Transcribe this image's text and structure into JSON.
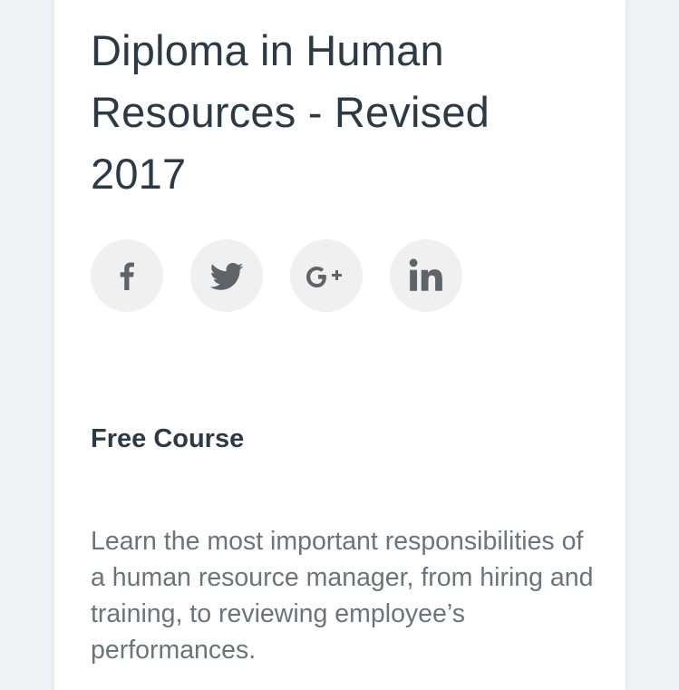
{
  "course": {
    "title": "Diploma in Human Resources - Revised 2017",
    "price_label": "Free Course",
    "description": "Learn the most important responsibilities of a human resource manager, from hiring and training, to reviewing employee’s performances."
  },
  "share": {
    "buttons": [
      {
        "icon": "facebook-icon"
      },
      {
        "icon": "twitter-icon"
      },
      {
        "icon": "google-plus-icon"
      },
      {
        "icon": "linkedin-icon"
      }
    ]
  },
  "colors": {
    "page_background": "#eef2f5",
    "card_background": "#ffffff",
    "title_text": "#2c3a47",
    "body_text": "#6b7479",
    "icon_circle": "#f0f0f0",
    "icon_glyph": "#5f6469"
  }
}
